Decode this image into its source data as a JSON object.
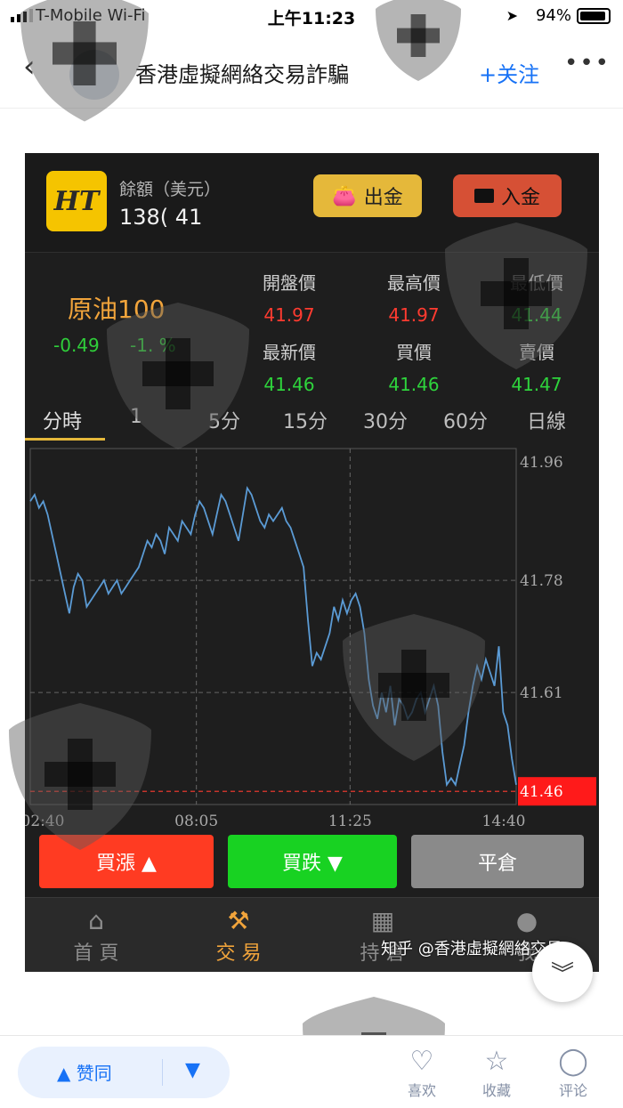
{
  "status_bar": {
    "carrier": "T-Mobile Wi-Fi",
    "time": "上午11:23",
    "battery": "94%"
  },
  "header": {
    "back_icon": "chevron-left-icon",
    "title": "香港虛擬網絡交易詐騙",
    "follow_label": "+关注",
    "more_label": "•••"
  },
  "app": {
    "balance_label": "餘額（美元）",
    "balance_value": "138(          41",
    "withdraw_label": "出金",
    "deposit_label": "入金",
    "symbol": "原油100",
    "change": "-0.49",
    "change_pct": "-1.  %",
    "quote_labels": [
      "開盤價",
      "最高價",
      "最低價",
      "最新價",
      "買價",
      "賣價"
    ],
    "quote_values": [
      "41.97",
      "41.97",
      "41.44",
      "41.46",
      "41.46",
      "41.47"
    ],
    "quote_colors": [
      "#ff3b30",
      "#ff3b30",
      "#2ed43c",
      "#2ed43c",
      "#2ed43c",
      "#2ed43c"
    ],
    "tabs": [
      "分時",
      "1",
      "5分",
      "15分",
      "30分",
      "60分",
      "日線"
    ],
    "active_tab": 0,
    "buy_label": "買漲 ▲",
    "sell_label": "買跌 ▼",
    "close_label": "平倉",
    "nav": [
      {
        "label": "首 頁",
        "icon": "home-icon",
        "active": false
      },
      {
        "label": "交 易",
        "icon": "gavel-icon",
        "active": true
      },
      {
        "label": "持 倉",
        "icon": "boxes-icon",
        "active": false
      },
      {
        "label": "我",
        "icon": "user-icon",
        "active": false
      }
    ],
    "credit": "知乎 @香港虛擬網絡交易"
  },
  "chart_data": {
    "type": "line",
    "x_ticks": [
      "02:40",
      "08:05",
      "11:25",
      "14:40"
    ],
    "y_ticks": [
      41.96,
      41.78,
      41.61
    ],
    "current_price": "41.46",
    "ylim": [
      41.44,
      41.98
    ],
    "series": [
      {
        "values": [
          41.9,
          41.91,
          41.89,
          41.9,
          41.88,
          41.85,
          41.82,
          41.79,
          41.76,
          41.73,
          41.77,
          41.79,
          41.78,
          41.74,
          41.75,
          41.76,
          41.77,
          41.78,
          41.76,
          41.77,
          41.78,
          41.76,
          41.77,
          41.78,
          41.79,
          41.8,
          41.82,
          41.84,
          41.83,
          41.85,
          41.84,
          41.82,
          41.86,
          41.85,
          41.84,
          41.87,
          41.86,
          41.85,
          41.88,
          41.9,
          41.89,
          41.87,
          41.85,
          41.88,
          41.91,
          41.9,
          41.88,
          41.86,
          41.84,
          41.88,
          41.92,
          41.91,
          41.89,
          41.87,
          41.86,
          41.88,
          41.87,
          41.88,
          41.89,
          41.87,
          41.86,
          41.84,
          41.82,
          41.8,
          41.72,
          41.65,
          41.67,
          41.66,
          41.68,
          41.7,
          41.74,
          41.72,
          41.75,
          41.73,
          41.75,
          41.76,
          41.74,
          41.7,
          41.63,
          41.59,
          41.57,
          41.61,
          41.58,
          41.62,
          41.56,
          41.6,
          41.59,
          41.57,
          41.58,
          41.6,
          41.61,
          41.58,
          41.6,
          41.62,
          41.59,
          41.52,
          41.47,
          41.48,
          41.47,
          41.5,
          41.53,
          41.58,
          41.62,
          41.65,
          41.63,
          41.66,
          41.64,
          41.62,
          41.68,
          41.58,
          41.56,
          41.51,
          41.47
        ]
      }
    ]
  },
  "bottom": {
    "upvote_label": "▲ 赞同",
    "downvote_label": "▼",
    "like_label": "喜欢",
    "fav_label": "收藏",
    "comment_label": "评论"
  }
}
